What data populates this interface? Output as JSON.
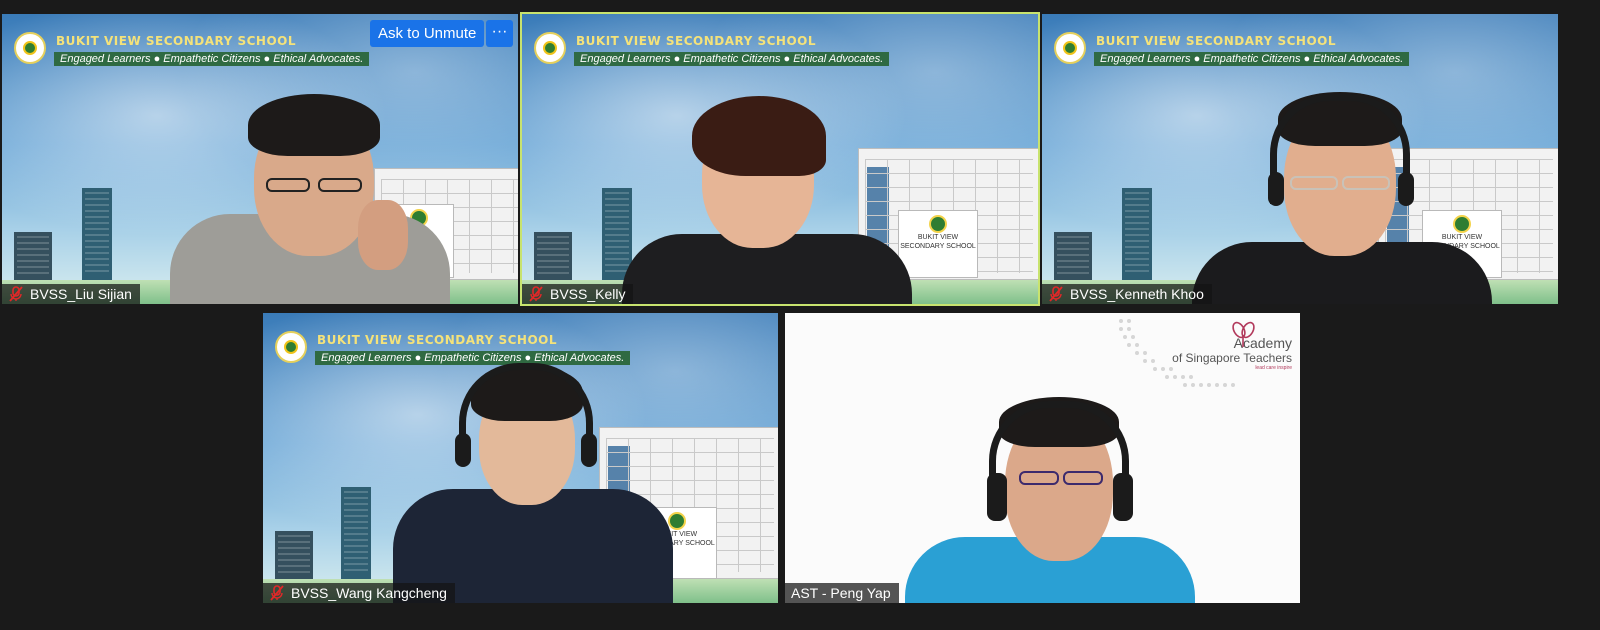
{
  "meeting": {
    "ask_to_unmute_label": "Ask to Unmute",
    "more_button_label": "···"
  },
  "school_banner": {
    "name": "BUKIT VIEW SECONDARY SCHOOL",
    "motto": "Engaged Learners ● Empathetic Citizens ● Ethical Advocates.",
    "sign_line1": "BUKIT VIEW",
    "sign_line2": "SECONDARY SCHOOL"
  },
  "participants": [
    {
      "name": "BVSS_Liu Sijian",
      "muted": true,
      "active_speaker": false
    },
    {
      "name": "BVSS_Kelly",
      "muted": true,
      "active_speaker": true
    },
    {
      "name": "BVSS_Kenneth Khoo",
      "muted": true,
      "active_speaker": false
    },
    {
      "name": "BVSS_Wang Kangcheng",
      "muted": true,
      "active_speaker": false
    },
    {
      "name": "AST - Peng Yap",
      "muted": false,
      "active_speaker": false
    }
  ],
  "ast_logo": {
    "line1": "Academy",
    "line2": "of Singapore Teachers",
    "tagline": "lead care inspire"
  },
  "colors": {
    "active_speaker_border": "#c8e36e",
    "button_blue": "#1a73e8",
    "muted_icon": "#e02828"
  }
}
